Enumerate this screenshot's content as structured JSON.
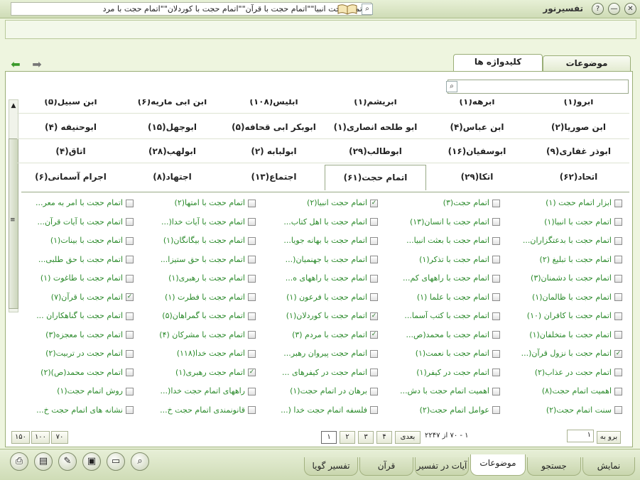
{
  "window": {
    "title": "تفسیرنور"
  },
  "search": {
    "query": "\"اتمام حجت انبیا\"\"اتمام حجت با قرآن\"\"اتمام حجت با کوردلان\"\"اتمام حجت با مرد",
    "search_icon": "search-icon",
    "book_icon": "quran-book-icon"
  },
  "top_tabs": {
    "topics": "موضوعات",
    "keywords": "کلیدواژه ها"
  },
  "keywords": {
    "rows": [
      [
        "ابرو(۱)",
        "ابرهه(۱)",
        "ابریشم(۱)",
        "ابلیس(۱۰۸)",
        "ابن ابی ماریه(۶)",
        "ابن سبیل(۵)"
      ],
      [
        "ابن صوریا(۲)",
        "ابن عباس(۴)",
        "ابو طلحه انصاری(۱)",
        "ابوبکر ابی قحافه(۵)",
        "ابوجهل(۱۵)",
        "ابوحنیفه (۴)"
      ],
      [
        "ابوذر غفاری(۹)",
        "ابوسفیان(۱۶)",
        "ابوطالب(۲۹)",
        "ابولبابه (۲)",
        "ابولهب(۲۸)",
        "اتاق(۴)"
      ],
      [
        "اتحاد(۶۲)",
        "اتکا(۲۹)",
        "اتمام حجت(۶۱)",
        "اجتماع(۱۳)",
        "اجتهاد(۸)",
        "اجرام آسمانی(۶)"
      ]
    ],
    "selected": "اتمام حجت(۶۱)"
  },
  "checklist": [
    [
      {
        "label": "ابزار اتمام حجت (۱)",
        "checked": false
      },
      {
        "label": "اتمام حجت(۳)",
        "checked": false
      },
      {
        "label": "اتمام حجت انبیا(۲)",
        "checked": true
      },
      {
        "label": "اتمام حجت با امتها(۲)",
        "checked": false
      },
      {
        "label": "اتمام حجت با امر به معر...",
        "checked": false
      }
    ],
    [
      {
        "label": "اتمام حجت با انبیا(۱)",
        "checked": false
      },
      {
        "label": "اتمام حجت با انسان(۱۳)",
        "checked": false
      },
      {
        "label": "اتمام حجت با اهل کتاب...",
        "checked": false
      },
      {
        "label": "اتمام حجت با آیات خدا(...",
        "checked": false
      },
      {
        "label": "اتمام حجت با آیات قرآن...",
        "checked": false
      }
    ],
    [
      {
        "label": "اتمام حجت با بدعتگزاران...",
        "checked": false
      },
      {
        "label": "اتمام حجت با بعثت انبیا...",
        "checked": false
      },
      {
        "label": "اتمام حجت با بهانه جویا...",
        "checked": false
      },
      {
        "label": "اتمام حجت با بیگانگان(۱)",
        "checked": false
      },
      {
        "label": "اتمام حجت با بینات(۱)",
        "checked": false
      }
    ],
    [
      {
        "label": "اتمام حجت با تبلیغ (۲)",
        "checked": false
      },
      {
        "label": "اتمام حجت با تذکر(۱)",
        "checked": false
      },
      {
        "label": "اتمام حجت با جهنمیان(...",
        "checked": false
      },
      {
        "label": "اتمام حجت با حق ستیزا...",
        "checked": false
      },
      {
        "label": "اتمام حجت با حق طلبی...",
        "checked": false
      }
    ],
    [
      {
        "label": "اتمام حجت با دشمنان(۳)",
        "checked": false
      },
      {
        "label": "اتمام حجت با راههای کم...",
        "checked": false
      },
      {
        "label": "اتمام حجت با راههای ه...",
        "checked": false
      },
      {
        "label": "اتمام حجت با رهبری(۱)",
        "checked": false
      },
      {
        "label": "اتمام حجت با طاغوت (۱)",
        "checked": false
      }
    ],
    [
      {
        "label": "اتمام حجت با ظالمان(۱)",
        "checked": false
      },
      {
        "label": "اتمام حجت با علما (۱)",
        "checked": false
      },
      {
        "label": "اتمام حجت با فرعون (۱)",
        "checked": false
      },
      {
        "label": "اتمام حجت با فطرت (۱)",
        "checked": false
      },
      {
        "label": "اتمام حجت با قرآن(۷)",
        "checked": true
      }
    ],
    [
      {
        "label": "اتمام حجت با کافران (۱۰)",
        "checked": false
      },
      {
        "label": "اتمام حجت با کتب آسما...",
        "checked": false
      },
      {
        "label": "اتمام حجت با کوردلان(۱)",
        "checked": true
      },
      {
        "label": "اتمام حجت با گمراهان(۵)",
        "checked": false
      },
      {
        "label": "اتمام حجت با گناهکاران ...",
        "checked": false
      }
    ],
    [
      {
        "label": "اتمام حجت با متخلفان(۱)",
        "checked": false
      },
      {
        "label": "اتمام حجت با محمد(ص...",
        "checked": false
      },
      {
        "label": "اتمام حجت با مردم (۳)",
        "checked": true
      },
      {
        "label": "اتمام حجت با مشرکان (۴)",
        "checked": false
      },
      {
        "label": "اتمام حجت با معجزه(۳)",
        "checked": false
      }
    ],
    [
      {
        "label": "اتمام حجت با نزول قرآن(...",
        "checked": true
      },
      {
        "label": "اتمام حجت با نعمت(۱)",
        "checked": false
      },
      {
        "label": "اتمام حجت پیروان رهبر...",
        "checked": false
      },
      {
        "label": "اتمام حجت خدا(۱۱۸)",
        "checked": false
      },
      {
        "label": "اتمام حجت در تربیت(۲)",
        "checked": false
      }
    ],
    [
      {
        "label": "اتمام حجت در عذاب(۲)",
        "checked": false
      },
      {
        "label": "اتمام حجت در کیفر(۱)",
        "checked": false
      },
      {
        "label": "اتمام حجت در کیفرهای ...",
        "checked": false
      },
      {
        "label": "اتمام حجت رهبری(۱)",
        "checked": true
      },
      {
        "label": "اتمام حجت محمد(ص)(۲)",
        "checked": false
      }
    ],
    [
      {
        "label": "اهمیت اتمام حجت(۸)",
        "checked": false
      },
      {
        "label": "اهمیت اتمام حجت با دش...",
        "checked": false
      },
      {
        "label": "برهان در اتمام حجت(۱)",
        "checked": false
      },
      {
        "label": "راههای اتمام حجت خدا(...",
        "checked": false
      },
      {
        "label": "روش اتمام حجت(۱)",
        "checked": false
      }
    ],
    [
      {
        "label": "سنت اتمام حجت(۲)",
        "checked": false
      },
      {
        "label": "عوامل اتمام حجت(۲)",
        "checked": false
      },
      {
        "label": "فلسفه اتمام حجت خدا (...",
        "checked": false
      },
      {
        "label": "قانونمندی اتمام حجت خ...",
        "checked": false
      },
      {
        "label": "نشانه های اتمام حجت خ...",
        "checked": false
      }
    ]
  ],
  "pagination": {
    "goto_label": "برو به",
    "goto_value": "۱",
    "range": "۱ - ۷۰ از ۲۲۴۷",
    "next_label": "بعدی",
    "pages": [
      "۱",
      "۲",
      "۳",
      "۴"
    ],
    "page_sizes": [
      "۷۰",
      "۱۰۰",
      "۱۵۰"
    ]
  },
  "bottom_tabs": [
    "نمایش",
    "جستجو",
    "موضوعات",
    "آیات در تفسیر",
    "قرآن",
    "تفسیر گویا"
  ],
  "bottom_tab_active": "موضوعات",
  "toolbar_icons": [
    "print-icon",
    "book-icon",
    "edit-icon",
    "window-icon",
    "page-icon",
    "search-icon"
  ],
  "colors": {
    "accent": "#2b8a2b",
    "frame": "#cfdcb6",
    "panel": "#ffffff"
  }
}
